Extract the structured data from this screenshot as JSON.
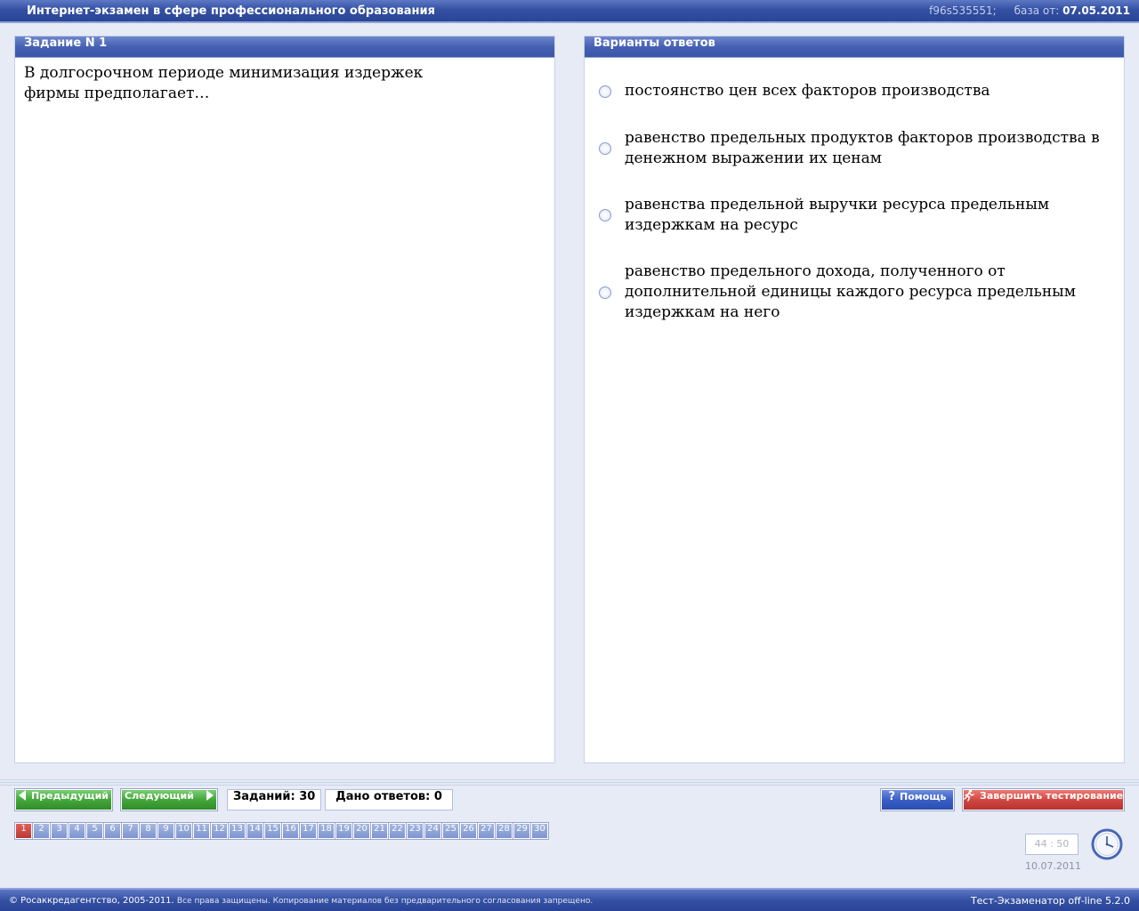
{
  "header": {
    "title": "Интернет-экзамен в сфере профессионального образования",
    "code": "f96s535551;",
    "base_label": "база от:",
    "base_date": "07.05.2011"
  },
  "task_panel": {
    "title": "Задание N 1",
    "question": "В долгосрочном периоде минимизация издержек фирмы предполагает…"
  },
  "answers_panel": {
    "title": "Варианты ответов",
    "options": [
      "постоянство цен всех факторов производства",
      "равенство предельных продуктов факторов производства в денежном выражении их ценам",
      "равенства предельной выручки ресурса предельным издержкам на ресурс",
      "равенство предельного дохода, полученного от дополнительной единицы каждого ресурса предельным издержкам на него"
    ]
  },
  "nav": {
    "prev_label": "Предыдущий",
    "next_label": "Следующий",
    "tasks_count": "Заданий: 30",
    "answers_given": "Дано ответов: 0",
    "help_label": "Помощь",
    "finish_label": "Завершить тестирование",
    "current_task": 1,
    "task_numbers": [
      "1",
      "2",
      "3",
      "4",
      "5",
      "6",
      "7",
      "8",
      "9",
      "10",
      "11",
      "12",
      "13",
      "14",
      "15",
      "16",
      "17",
      "18",
      "19",
      "20",
      "21",
      "22",
      "23",
      "24",
      "25",
      "26",
      "27",
      "28",
      "29",
      "30"
    ]
  },
  "timer": {
    "time": "44 : 50",
    "date": "10.07.2011"
  },
  "footer": {
    "copyright": "© Росаккредагентство, 2005-2011.",
    "notice": "Все права защищены. Копирование материалов без предварительного согласования запрещено.",
    "version": "Тест-Экзаменатор off-line 5.2.0"
  },
  "colors": {
    "header_blue": "#3450a3",
    "nav_green": "#44a63b",
    "help_blue": "#3a5fc6",
    "finish_red": "#d24842",
    "current_task_red": "#c9443e",
    "task_blue": "#8fa4d8"
  }
}
